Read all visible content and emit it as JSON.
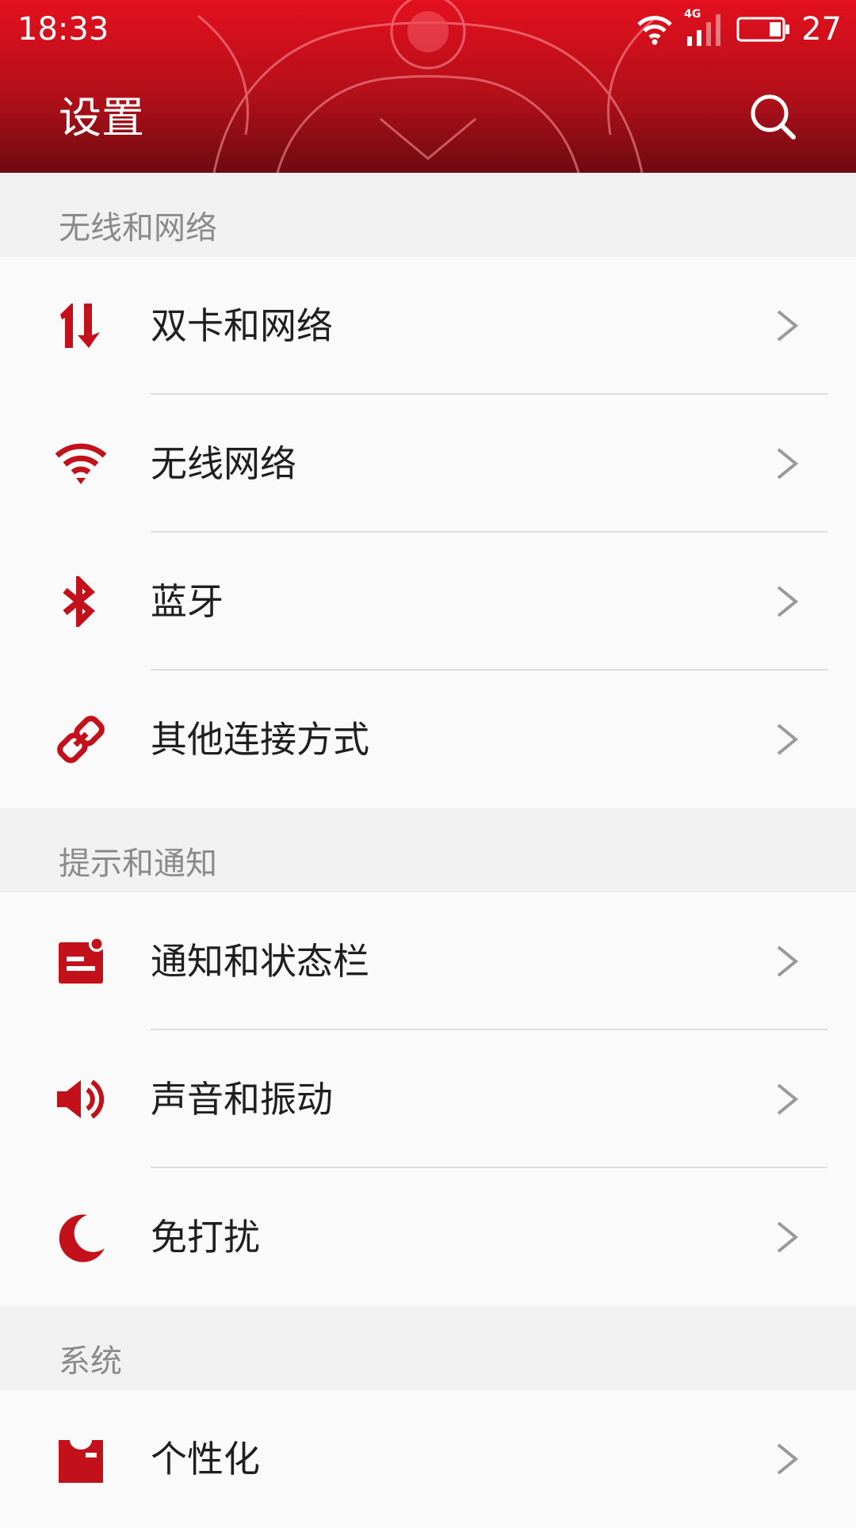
{
  "status_bar": {
    "time": "18:33",
    "network_label": "4G",
    "battery": "27"
  },
  "toolbar": {
    "title": "设置",
    "search_icon": "search-icon"
  },
  "colors": {
    "accent": "#c3111c",
    "header_top": "#e4101e",
    "header_bottom": "#6e0a10",
    "section_text": "#8a8a8a",
    "item_text": "#1f1f1f"
  },
  "sections": [
    {
      "title": "无线和网络",
      "items": [
        {
          "label": "双卡和网络",
          "icon": "dual-sim-data-icon"
        },
        {
          "label": "无线网络",
          "icon": "wifi-icon"
        },
        {
          "label": "蓝牙",
          "icon": "bluetooth-icon"
        },
        {
          "label": "其他连接方式",
          "icon": "link-icon"
        }
      ]
    },
    {
      "title": "提示和通知",
      "items": [
        {
          "label": "通知和状态栏",
          "icon": "notification-icon"
        },
        {
          "label": "声音和振动",
          "icon": "speaker-icon"
        },
        {
          "label": "免打扰",
          "icon": "moon-icon"
        }
      ]
    },
    {
      "title": "系统",
      "items": [
        {
          "label": "个性化",
          "icon": "personalization-icon"
        }
      ]
    }
  ]
}
